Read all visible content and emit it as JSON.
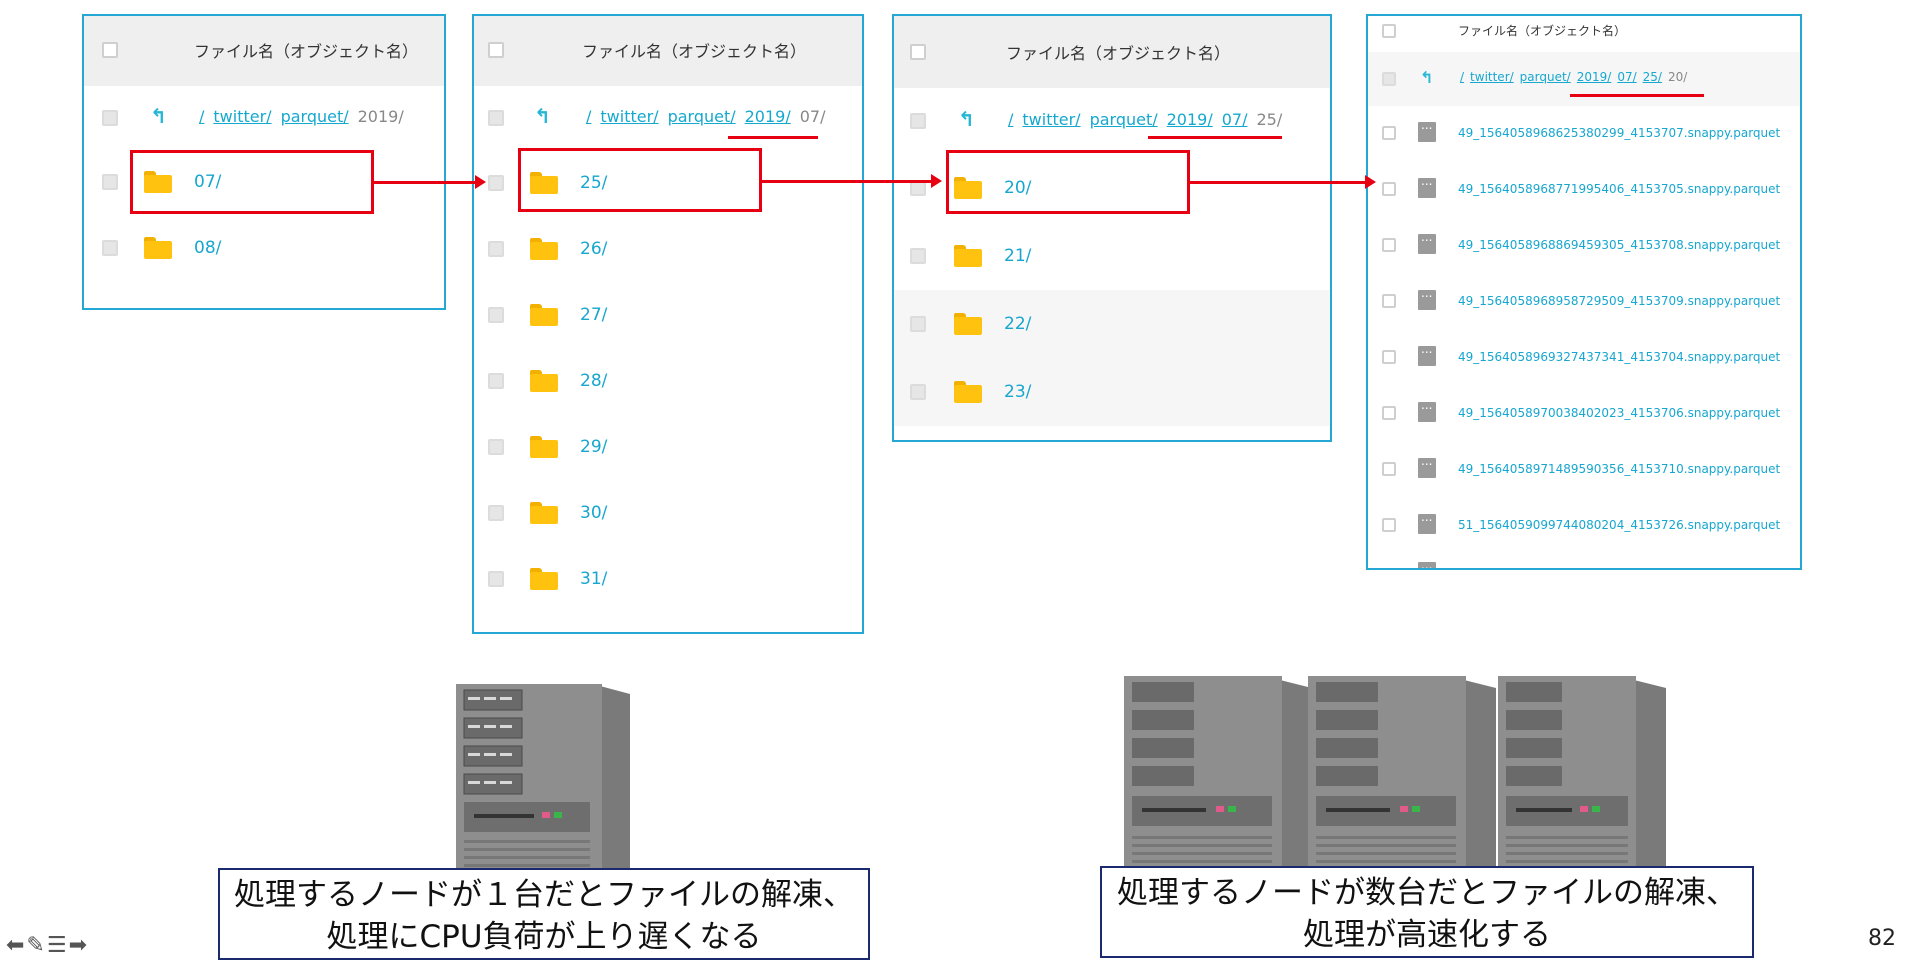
{
  "header_label": "ファイル名（オブジェクト名）",
  "panel1": {
    "breadcrumb_links": [
      "/",
      "twitter/",
      "parquet/"
    ],
    "breadcrumb_current": "2019/",
    "rows": [
      "07/",
      "08/"
    ]
  },
  "panel2": {
    "breadcrumb_links": [
      "/",
      "twitter/",
      "parquet/",
      "2019/"
    ],
    "breadcrumb_current": "07/",
    "rows": [
      "25/",
      "26/",
      "27/",
      "28/",
      "29/",
      "30/",
      "31/"
    ]
  },
  "panel3": {
    "breadcrumb_links": [
      "/",
      "twitter/",
      "parquet/",
      "2019/",
      "07/"
    ],
    "breadcrumb_current": "25/",
    "rows": [
      "20/",
      "21/",
      "22/",
      "23/"
    ]
  },
  "panel4": {
    "breadcrumb_links": [
      "/",
      "twitter/",
      "parquet/",
      "2019/",
      "07/",
      "25/"
    ],
    "breadcrumb_current": "20/",
    "files": [
      "49_1564058968625380299_4153707.snappy.parquet",
      "49_1564058968771995406_4153705.snappy.parquet",
      "49_1564058968869459305_4153708.snappy.parquet",
      "49_1564058968958729509_4153709.snappy.parquet",
      "49_1564058969327437341_4153704.snappy.parquet",
      "49_1564058970038402023_4153706.snappy.parquet",
      "49_1564058971489590356_4153710.snappy.parquet",
      "51_1564059099744080204_4153726.snappy.parquet"
    ]
  },
  "caption_left": [
    "処理するノードが１台だとファイルの解凍、",
    "処理にCPU負荷が上り遅くなる"
  ],
  "caption_right": [
    "処理するノードが数台だとファイルの解凍、",
    "処理が高速化する"
  ],
  "nav_icons": "⬅✎☰➡",
  "page_number": "82",
  "colors": {
    "panel_border": "#25a7d6",
    "link": "#17a6cf",
    "highlight": "#e60012",
    "folder": "#ffc20e",
    "caption_border": "#1a2a6c"
  }
}
